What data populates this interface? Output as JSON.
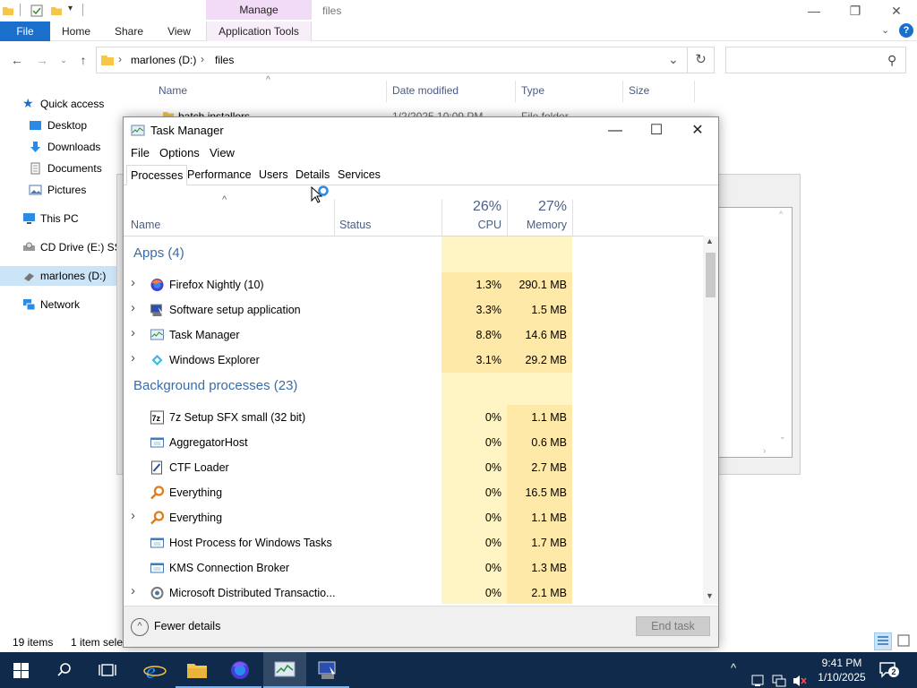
{
  "explorer": {
    "title": "files",
    "contextual_tab": "Manage",
    "ribbon_tabs": [
      "File",
      "Home",
      "Share",
      "View",
      "Application Tools"
    ],
    "breadcrumb": [
      "marIones (D:)",
      "files"
    ],
    "columns": [
      "Name",
      "Date modified",
      "Type",
      "Size"
    ],
    "peek_row": {
      "name": "batch installers",
      "date": "1/2/2025 10:09 PM",
      "type": "File folder"
    },
    "nav": [
      "Quick access",
      "Desktop",
      "Downloads",
      "Documents",
      "Pictures",
      "This PC",
      "CD Drive (E:) SSS",
      "marIones (D:)",
      "Network"
    ],
    "status_count": "19 items",
    "status_selected": "1 item sele"
  },
  "taskmanager": {
    "title": "Task Manager",
    "menu": [
      "File",
      "Options",
      "View"
    ],
    "tabs": [
      "Processes",
      "Performance",
      "Users",
      "Details",
      "Services"
    ],
    "active_tab": "Processes",
    "headers": {
      "name": "Name",
      "status": "Status",
      "cpu_pct": "26%",
      "cpu": "CPU",
      "mem_pct": "27%",
      "mem": "Memory"
    },
    "apps_group": "Apps (4)",
    "apps": [
      {
        "name": "Firefox Nightly (10)",
        "cpu": "1.3%",
        "mem": "290.1 MB",
        "icon": "firefox-icon",
        "expand": true
      },
      {
        "name": "Software setup application",
        "cpu": "3.3%",
        "mem": "1.5 MB",
        "icon": "setup-icon",
        "expand": true
      },
      {
        "name": "Task Manager",
        "cpu": "8.8%",
        "mem": "14.6 MB",
        "icon": "taskmanager-icon",
        "expand": true
      },
      {
        "name": "Windows Explorer",
        "cpu": "3.1%",
        "mem": "29.2 MB",
        "icon": "explorer-icon",
        "expand": true
      }
    ],
    "bg_group": "Background processes (23)",
    "background": [
      {
        "name": "7z Setup SFX small (32 bit)",
        "cpu": "0%",
        "mem": "1.1 MB",
        "icon": "7z-icon",
        "expand": false
      },
      {
        "name": "AggregatorHost",
        "cpu": "0%",
        "mem": "0.6 MB",
        "icon": "window-icon",
        "expand": false
      },
      {
        "name": "CTF Loader",
        "cpu": "0%",
        "mem": "2.7 MB",
        "icon": "ctf-icon",
        "expand": false
      },
      {
        "name": "Everything",
        "cpu": "0%",
        "mem": "16.5 MB",
        "icon": "magnifier-icon",
        "expand": false
      },
      {
        "name": "Everything",
        "cpu": "0%",
        "mem": "1.1 MB",
        "icon": "magnifier-icon",
        "expand": true
      },
      {
        "name": "Host Process for Windows Tasks",
        "cpu": "0%",
        "mem": "1.7 MB",
        "icon": "window-icon",
        "expand": false
      },
      {
        "name": "KMS Connection Broker",
        "cpu": "0%",
        "mem": "1.3 MB",
        "icon": "window-icon",
        "expand": false
      },
      {
        "name": "Microsoft Distributed Transactio...",
        "cpu": "0%",
        "mem": "2.1 MB",
        "icon": "msdtc-icon",
        "expand": true
      }
    ],
    "fewer_details": "Fewer details",
    "end_task": "End task"
  },
  "taskbar": {
    "time": "9:41 PM",
    "date": "1/10/2025",
    "notification_count": "2"
  },
  "colors": {
    "accent": "#1a6fcc",
    "heat_light": "#fff4c4",
    "heat_dark": "#ffe9a8",
    "taskbar": "#0f2a4a",
    "group_text": "#3a6ca8"
  }
}
